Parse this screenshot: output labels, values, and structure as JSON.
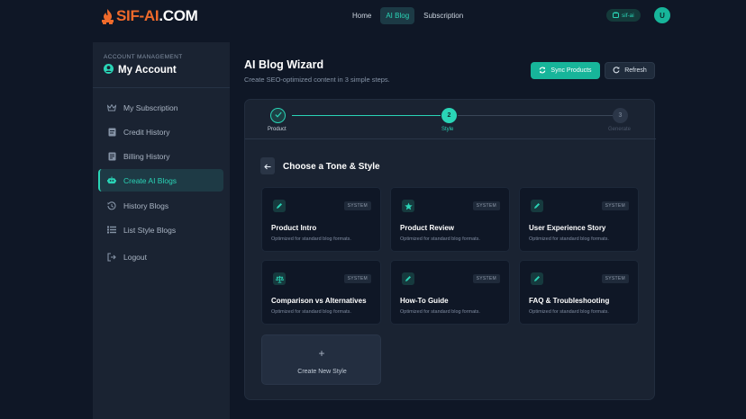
{
  "brand": {
    "logo_accent": "SIF-AI",
    "logo_rest": ".COM"
  },
  "nav": {
    "items": [
      {
        "label": "Home"
      },
      {
        "label": "AI Blog"
      },
      {
        "label": "Subscription"
      }
    ],
    "active": "AI Blog"
  },
  "wallet": {
    "label": "sif-ai"
  },
  "user": {
    "initial": "U"
  },
  "sidebar": {
    "caption": "ACCOUNT MANAGEMENT",
    "title": "My Account",
    "items": [
      {
        "label": "My Subscription",
        "icon": "crown-icon"
      },
      {
        "label": "Credit History",
        "icon": "receipt-icon"
      },
      {
        "label": "Billing History",
        "icon": "invoice-icon"
      },
      {
        "label": "Create AI Blogs",
        "icon": "robot-icon",
        "active": true
      },
      {
        "label": "History Blogs",
        "icon": "history-icon"
      },
      {
        "label": "List Style Blogs",
        "icon": "list-icon"
      },
      {
        "label": "Logout",
        "icon": "logout-icon"
      }
    ]
  },
  "header": {
    "title": "AI Blog Wizard",
    "subtitle": "Create SEO-optimized content in 3 simple steps.",
    "sync_label": "Sync Products",
    "refresh_label": "Refresh"
  },
  "wizard": {
    "steps": [
      {
        "label": "Product",
        "number": "",
        "state": "done"
      },
      {
        "label": "Style",
        "number": "2",
        "state": "active"
      },
      {
        "label": "Generate",
        "number": "3",
        "state": "pending"
      }
    ],
    "section_title": "Choose a Tone & Style",
    "styles": [
      {
        "name": "Product Intro",
        "desc": "Optimized for standard blog formats.",
        "badge": "SYSTEM",
        "icon": "pencil-icon"
      },
      {
        "name": "Product Review",
        "desc": "Optimized for standard blog formats.",
        "badge": "SYSTEM",
        "icon": "star-icon"
      },
      {
        "name": "User Experience Story",
        "desc": "Optimized for standard blog formats.",
        "badge": "SYSTEM",
        "icon": "pencil-icon"
      },
      {
        "name": "Comparison vs Alternatives",
        "desc": "Optimized for standard blog formats.",
        "badge": "SYSTEM",
        "icon": "scale-icon"
      },
      {
        "name": "How-To Guide",
        "desc": "Optimized for standard blog formats.",
        "badge": "SYSTEM",
        "icon": "pencil-icon"
      },
      {
        "name": "FAQ & Troubleshooting",
        "desc": "Optimized for standard blog formats.",
        "badge": "SYSTEM",
        "icon": "pencil-icon"
      }
    ],
    "new_style_label": "Create New Style",
    "new_style_plus": "+"
  },
  "colors": {
    "accent": "#2ad4b6",
    "accent_button": "#17b59a",
    "brand_orange": "#ef6a2b",
    "background": "#0f1726",
    "panel": "#1a2332"
  }
}
